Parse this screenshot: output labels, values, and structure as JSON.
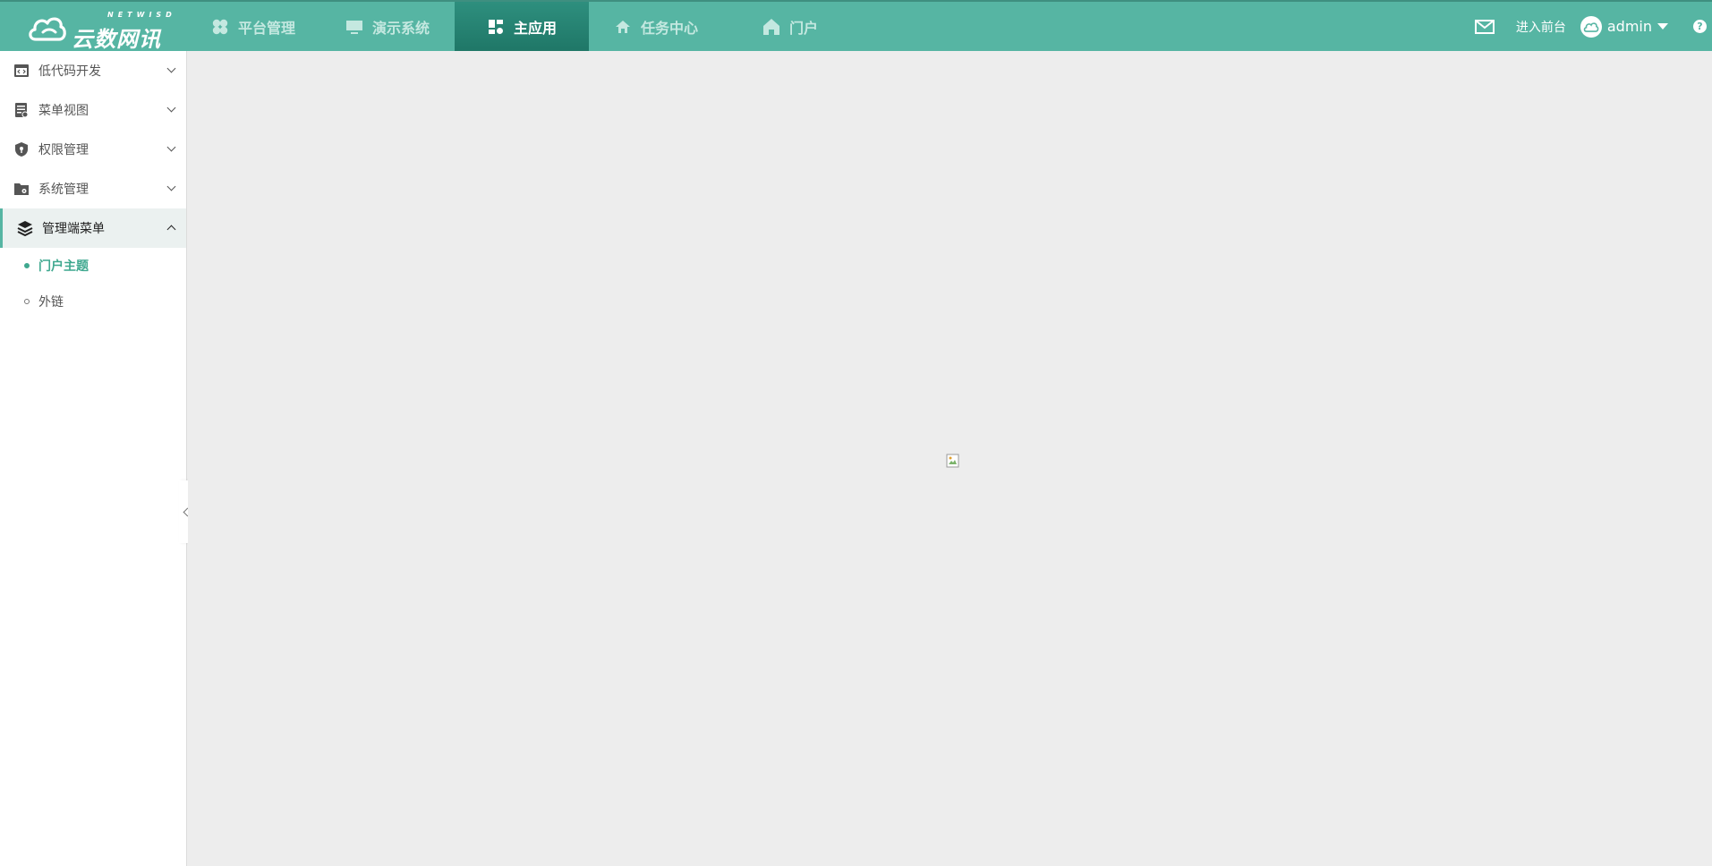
{
  "logo": {
    "text": "云数网讯",
    "sub": "NETWISD"
  },
  "topnav": {
    "items": [
      {
        "label": "平台管理",
        "icon": "clover-icon"
      },
      {
        "label": "演示系统",
        "icon": "monitor-icon"
      },
      {
        "label": "主应用",
        "icon": "dashboard-icon"
      },
      {
        "label": "任务中心",
        "icon": "home-icon"
      },
      {
        "label": "门户",
        "icon": "house-icon"
      }
    ],
    "active_index": 2
  },
  "header_right": {
    "front_label": "进入前台",
    "user_name": "admin",
    "help": "?"
  },
  "sidebar": {
    "menus": [
      {
        "label": "低代码开发",
        "icon": "code-window-icon"
      },
      {
        "label": "菜单视图",
        "icon": "document-icon"
      },
      {
        "label": "权限管理",
        "icon": "shield-icon"
      },
      {
        "label": "系统管理",
        "icon": "folder-gear-icon"
      },
      {
        "label": "管理端菜单",
        "icon": "layers-icon",
        "open": true
      }
    ],
    "submenu": [
      {
        "label": "门户主题",
        "active": true
      },
      {
        "label": "外链",
        "active": false
      }
    ]
  },
  "colors": {
    "header": "#56b5a3",
    "active_tab": "#1f7767",
    "accent": "#3fa88f",
    "content_bg": "#ededed"
  }
}
